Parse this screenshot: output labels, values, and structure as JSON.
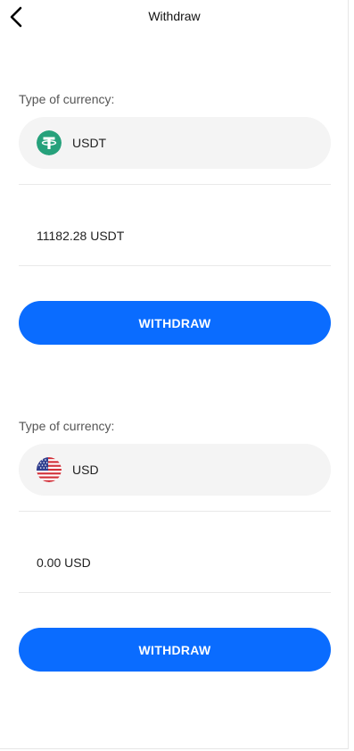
{
  "header": {
    "title": "Withdraw"
  },
  "wallets": [
    {
      "label": "Type of currency:",
      "currency": "USDT",
      "icon": "tether-icon",
      "icon_color": "#26a17b",
      "balance": "11182.28 USDT",
      "button_label": "WITHDRAW"
    },
    {
      "label": "Type of currency:",
      "currency": "USD",
      "icon": "us-flag-icon",
      "balance": "0.00 USD",
      "button_label": "WITHDRAW"
    }
  ],
  "colors": {
    "accent": "#0a6cff",
    "field_bg": "#f4f4f4"
  }
}
